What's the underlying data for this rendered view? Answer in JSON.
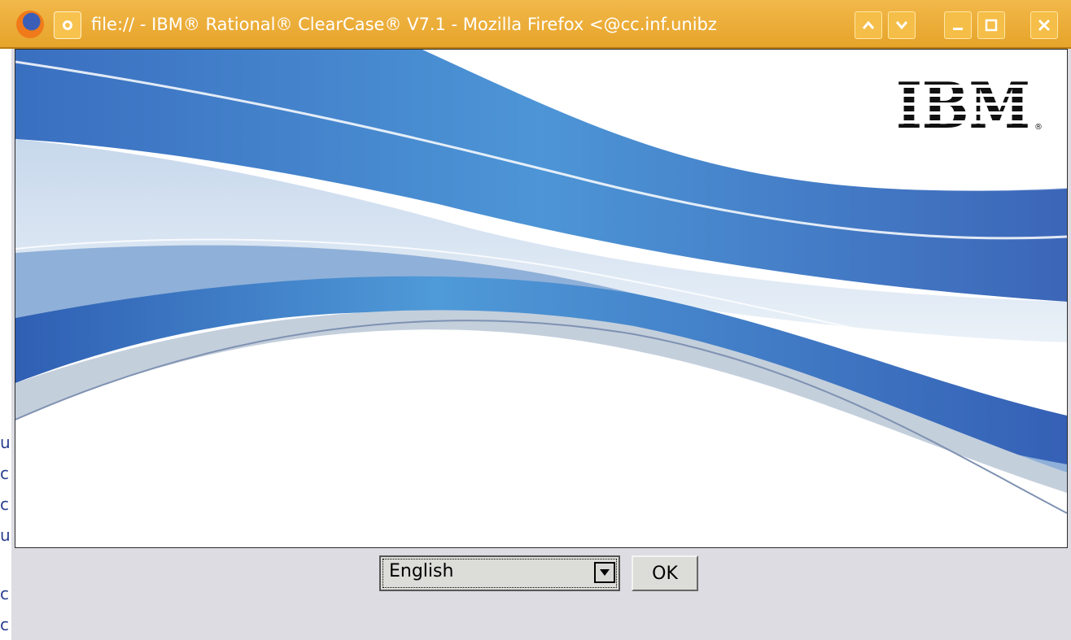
{
  "window": {
    "title": "file:// - IBM® Rational® ClearCase® V7.1 - Mozilla Firefox <@cc.inf.unibz",
    "app_icon": "firefox-icon",
    "menu_icon": "window-menu-icon",
    "buttons": {
      "scroll_up": "chevron-up-icon",
      "scroll_down": "chevron-down-icon",
      "minimize": "minimize-icon",
      "maximize": "maximize-icon",
      "close": "close-icon"
    },
    "accent_color": "#e8a52c"
  },
  "background_fragments": [
    "u",
    "c",
    "c",
    "u",
    "c",
    "c"
  ],
  "splash": {
    "logo_text": "IBM",
    "logo_mark": "®"
  },
  "language_select": {
    "selected": "English"
  },
  "ok_button": {
    "label": "OK"
  }
}
